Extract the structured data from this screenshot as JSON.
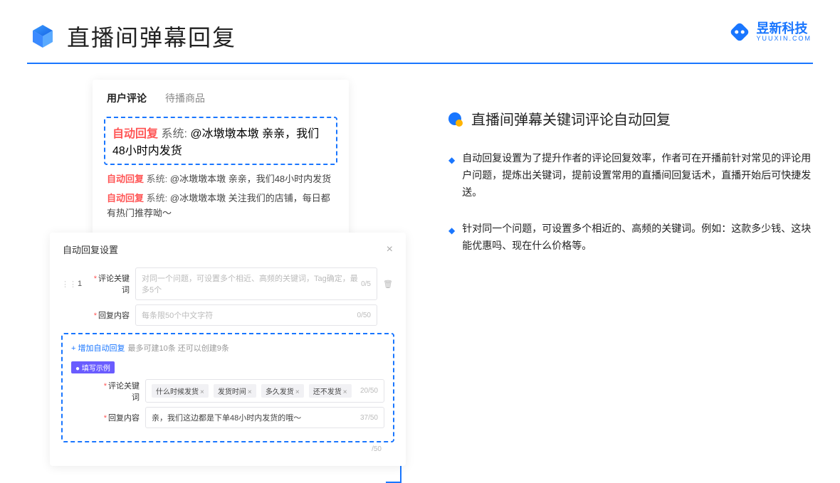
{
  "header": {
    "title": "直播间弹幕回复"
  },
  "brand": {
    "cn": "昱新科技",
    "en": "YUUXIN.COM"
  },
  "comments": {
    "tabs": {
      "active": "用户评论",
      "inactive": "待播商品"
    },
    "highlighted": {
      "tag": "自动回复",
      "sys": "系统:",
      "text": "@冰墩墩本墩 亲亲，我们48小时内发货"
    },
    "lines": [
      {
        "tag": "自动回复",
        "sys": "系统:",
        "text": "@冰墩墩本墩 亲亲，我们48小时内发货"
      },
      {
        "tag": "自动回复",
        "sys": "系统:",
        "text": "@冰墩墩本墩 关注我们的店铺，每日都有热门推荐呦～"
      }
    ]
  },
  "settings": {
    "title": "自动回复设置",
    "idx": "1",
    "kw_label": "评论关键词",
    "kw_placeholder": "对同一个问题，可设置多个相近、高频的关键词，Tag确定，最多5个",
    "kw_cnt": "0/5",
    "content_label": "回复内容",
    "content_placeholder": "每条限50个中文字符",
    "content_cnt": "0/50",
    "add_link": "+ 增加自动回复",
    "add_hint": "最多可建10条 还可以创建9条",
    "example_badge": "● 填写示例",
    "ex_kw_label": "评论关键词",
    "ex_tags": [
      "什么时候发货",
      "发货时间",
      "多久发货",
      "还不发货"
    ],
    "ex_kw_cnt": "20/50",
    "ex_content_label": "回复内容",
    "ex_content_text": "亲，我们这边都是下单48小时内发货的哦～",
    "ex_content_cnt": "37/50",
    "footer_cnt": "/50"
  },
  "right": {
    "title": "直播间弹幕关键词评论自动回复",
    "p1": "自动回复设置为了提升作者的评论回复效率，作者可在开播前针对常见的评论用户问题，提炼出关键词，提前设置常用的直播间回复话术，直播开始后可快捷发送。",
    "p2": "针对同一个问题，可设置多个相近的、高频的关键词。例如：这款多少钱、这块能优惠吗、现在什么价格等。"
  }
}
